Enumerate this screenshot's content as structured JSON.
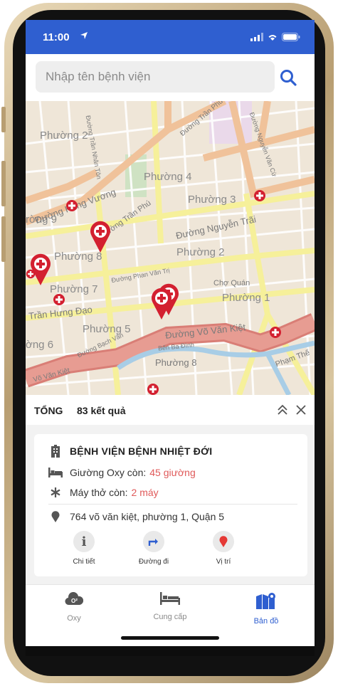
{
  "status": {
    "time": "11:00"
  },
  "search": {
    "placeholder": "Nhập tên bệnh viện"
  },
  "map": {
    "labels": {
      "p2_top": "Phường 2",
      "p4": "Phường 4",
      "p3": "Phường 3",
      "p9": "rờng 9",
      "p8": "Phường 8",
      "p2_mid": "Phường 2",
      "p7": "Phường 7",
      "p1": "Phường 1",
      "p5": "Phường 5",
      "p6": "ờng 6",
      "p8_low": "Phường 8",
      "st_hung_vuong": "Đường Hùng Vương",
      "st_tran_phu": "Đường Trần Phú",
      "st_nguyen_trai": "Đường Nguyễn Trãi",
      "st_vo_van_kiet": "Đường Võ Văn Kiệt",
      "st_tran_hung_dao": "Trần Hưng Đạo",
      "st_phan_van_tri": "Đường Phan Văn Trị",
      "st_bach_van": "Đường Bạch Vân",
      "st_ben_ba_dinh": "Bến Ba Đình",
      "st_cho_quan": "Chợ Quán",
      "st_nguyen_van_cu": "Đường Nguyễn Văn Cừ",
      "st_pham_the": "Phạm Thế",
      "st_tran_nhan_ton": "Đường Trần Nhân Tôn",
      "st_vo_van_kiet_left": "Võ Văn Kiệt",
      "st_tran_phu_top": "Đường Trần Phú"
    }
  },
  "results": {
    "total_label": "TỔNG",
    "count_text": "83 kết quả"
  },
  "hospital": {
    "name": "BỆNH VIỆN BỆNH NHIỆT ĐỚI",
    "oxy_label": "Giường Oxy còn:",
    "oxy_value": "45 giường",
    "vent_label": "Máy thở còn:",
    "vent_value": "2 máy",
    "address": "764 võ văn kiệt, phường 1, Quận 5",
    "actions": {
      "detail": "Chi tiết",
      "route": "Đường đi",
      "location": "Vị trí"
    }
  },
  "tabs": {
    "oxy": "Oxy",
    "supply": "Cung cấp",
    "map": "Bản đồ"
  },
  "colors": {
    "primary": "#2f5fd0",
    "accent_red": "#e05a5a",
    "pin_red": "#d32030"
  }
}
